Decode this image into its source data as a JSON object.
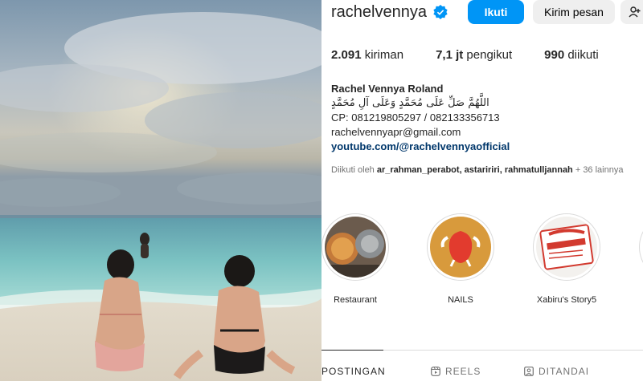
{
  "profile": {
    "username": "rachelvennya",
    "follow_label": "Ikuti",
    "message_label": "Kirim pesan",
    "add_label": "+²",
    "stats": {
      "posts_value": "2.091",
      "posts_label": "kiriman",
      "followers_value": "7,1 jt",
      "followers_label": "pengikut",
      "following_value": "990",
      "following_label": "diikuti"
    },
    "bio": {
      "name": "Rachel Vennya Roland",
      "arabic": "اللَّهُمَّ صَلِّ عَلَى مُحَمَّدٍ وَعَلَى آلِ مُحَمَّدٍ",
      "cp": "CP: 081219805297 / 082133356713",
      "email": "rachelvennyapr@gmail.com",
      "link": "youtube.com/@rachelvennyaofficial"
    },
    "followed_by": {
      "prefix": "Diikuti oleh ",
      "names": "ar_rahman_perabot, astaririri, rahmatulljannah",
      "suffix": " + 36 lainnya"
    },
    "highlights": [
      {
        "label": "Restaurant"
      },
      {
        "label": "NAILS"
      },
      {
        "label": "Xabiru's Story5"
      }
    ],
    "tabs": [
      {
        "label": "POSTINGAN",
        "icon": "grid-icon"
      },
      {
        "label": "REELS",
        "icon": "reels-icon"
      },
      {
        "label": "DITANDAI",
        "icon": "tagged-icon"
      }
    ],
    "colors": {
      "primary_button": "#0095f6",
      "secondary_button": "#efefef",
      "link": "#00376b",
      "verified": "#0095f6"
    }
  }
}
